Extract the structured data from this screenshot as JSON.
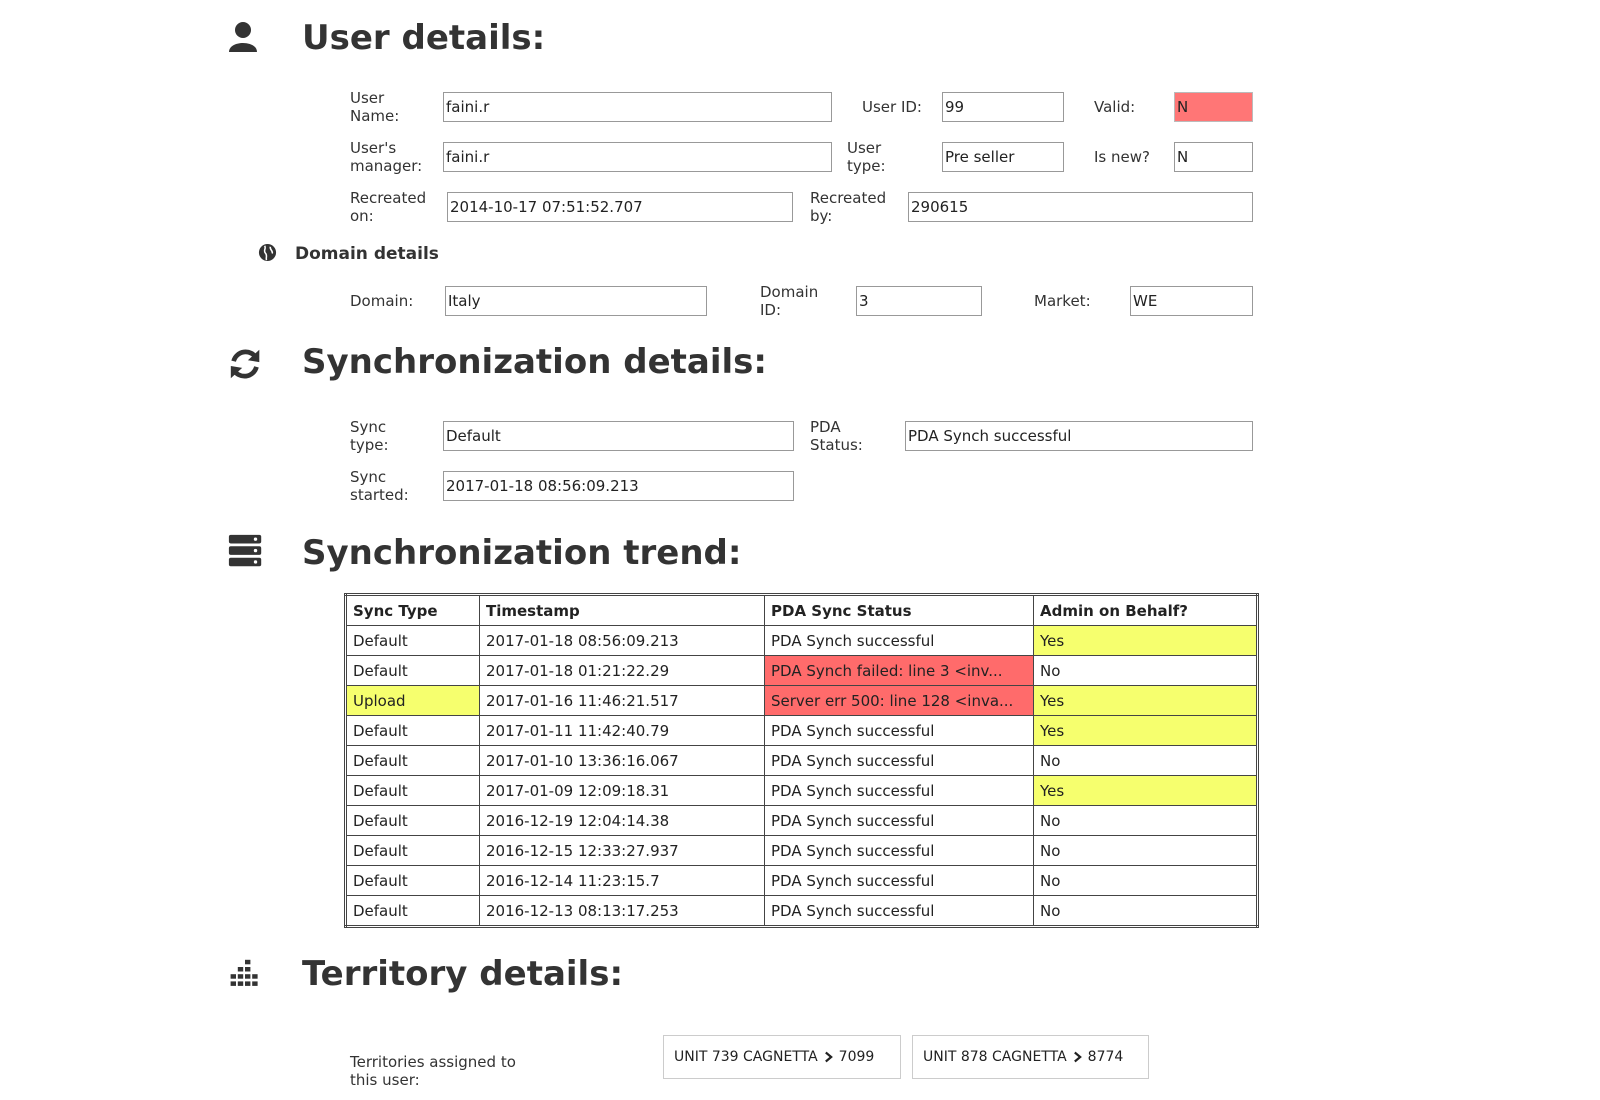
{
  "user": {
    "title": "User details:",
    "username_label": "User Name:",
    "username": "faini.r",
    "userid_label": "User ID:",
    "userid": "99",
    "valid_label": "Valid:",
    "valid": "N",
    "manager_label": "User's manager:",
    "manager": "faini.r",
    "usertype_label": "User type:",
    "usertype": "Pre seller",
    "isnew_label": "Is new?",
    "isnew": "N",
    "recreated_on_label": "Recreated on:",
    "recreated_on": "2014-10-17 07:51:52.707",
    "recreated_by_label": "Recreated by:",
    "recreated_by": "290615"
  },
  "domain": {
    "title": "Domain details",
    "domain_label": "Domain:",
    "domain": "Italy",
    "domain_id_label": "Domain ID:",
    "domain_id": "3",
    "market_label": "Market:",
    "market": "WE"
  },
  "sync": {
    "title": "Synchronization details:",
    "sync_type_label": "Sync type:",
    "sync_type": "Default",
    "pda_status_label": "PDA Status:",
    "pda_status": "PDA Synch successful",
    "sync_started_label": "Sync started:",
    "sync_started": "2017-01-18 08:56:09.213"
  },
  "trend": {
    "title": "Synchronization trend:",
    "headers": [
      "Sync Type",
      "Timestamp",
      "PDA Sync Status",
      "Admin on Behalf?"
    ],
    "rows": [
      {
        "sync_type": "Default",
        "timestamp": "2017-01-18 08:56:09.213",
        "status": "PDA Synch successful",
        "admin": "Yes",
        "type_hl": "",
        "status_hl": "",
        "admin_hl": "yel"
      },
      {
        "sync_type": "Default",
        "timestamp": "2017-01-18 01:21:22.29",
        "status": "PDA Synch failed: line 3 <inv...",
        "admin": "No",
        "type_hl": "",
        "status_hl": "red",
        "admin_hl": ""
      },
      {
        "sync_type": "Upload",
        "timestamp": "2017-01-16 11:46:21.517",
        "status": "Server err 500: line 128 <inva...",
        "admin": "Yes",
        "type_hl": "yel",
        "status_hl": "red",
        "admin_hl": "yel"
      },
      {
        "sync_type": "Default",
        "timestamp": "2017-01-11 11:42:40.79",
        "status": "PDA Synch successful",
        "admin": "Yes",
        "type_hl": "",
        "status_hl": "",
        "admin_hl": "yel"
      },
      {
        "sync_type": "Default",
        "timestamp": "2017-01-10 13:36:16.067",
        "status": "PDA Synch successful",
        "admin": "No",
        "type_hl": "",
        "status_hl": "",
        "admin_hl": ""
      },
      {
        "sync_type": "Default",
        "timestamp": "2017-01-09 12:09:18.31",
        "status": "PDA Synch successful",
        "admin": "Yes",
        "type_hl": "",
        "status_hl": "",
        "admin_hl": "yel"
      },
      {
        "sync_type": "Default",
        "timestamp": "2016-12-19 12:04:14.38",
        "status": "PDA Synch successful",
        "admin": "No",
        "type_hl": "",
        "status_hl": "",
        "admin_hl": ""
      },
      {
        "sync_type": "Default",
        "timestamp": "2016-12-15 12:33:27.937",
        "status": "PDA Synch successful",
        "admin": "No",
        "type_hl": "",
        "status_hl": "",
        "admin_hl": ""
      },
      {
        "sync_type": "Default",
        "timestamp": "2016-12-14 11:23:15.7",
        "status": "PDA Synch successful",
        "admin": "No",
        "type_hl": "",
        "status_hl": "",
        "admin_hl": ""
      },
      {
        "sync_type": "Default",
        "timestamp": "2016-12-13 08:13:17.253",
        "status": "PDA Synch successful",
        "admin": "No",
        "type_hl": "",
        "status_hl": "",
        "admin_hl": ""
      }
    ]
  },
  "territory": {
    "title": "Territory details:",
    "assigned_label": "Territories assigned to this user:",
    "items": [
      {
        "unit": "UNIT 739 CAGNETTA",
        "code": "7099"
      },
      {
        "unit": "UNIT 878 CAGNETTA",
        "code": "8774"
      }
    ]
  },
  "icons": {
    "user": "user-icon",
    "domain": "globe-icon",
    "sync": "refresh-icon",
    "trend": "server-icon",
    "territory": "bar-chart-icon",
    "territory_chevron": "chevron-right-icon"
  },
  "colors": {
    "invalid_red": "#ff7676",
    "failure_red": "#ff6b6b",
    "highlight_yellow": "#f6ff6e"
  }
}
